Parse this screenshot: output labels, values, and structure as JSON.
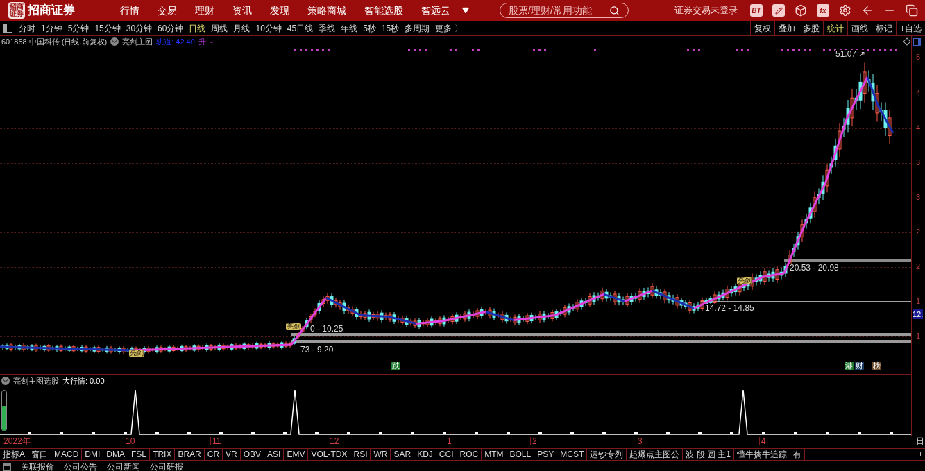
{
  "app_bar": {
    "logo_emblem": "招商证券",
    "logo_text": "招商证券",
    "nav": [
      "行情",
      "交易",
      "理财",
      "资讯",
      "发现",
      "策略商城",
      "智能选股",
      "智远云"
    ],
    "search": {
      "placeholder": "股票/理财/常用功能"
    },
    "login_status": "证券交易未登录",
    "tools": [
      {
        "kind": "text",
        "label": "BT"
      },
      {
        "kind": "pencil"
      },
      {
        "kind": "box"
      },
      {
        "kind": "text",
        "label": "fx"
      },
      {
        "kind": "gear"
      },
      {
        "kind": "back"
      },
      {
        "kind": "minimize"
      },
      {
        "kind": "restore"
      }
    ]
  },
  "periods": [
    {
      "label": "分时",
      "selected": false
    },
    {
      "label": "1分钟",
      "selected": false
    },
    {
      "label": "5分钟",
      "selected": false
    },
    {
      "label": "15分钟",
      "selected": false
    },
    {
      "label": "30分钟",
      "selected": false
    },
    {
      "label": "60分钟",
      "selected": false
    },
    {
      "label": "日线",
      "selected": true
    },
    {
      "label": "周线",
      "selected": false
    },
    {
      "label": "月线",
      "selected": false
    },
    {
      "label": "10分钟",
      "selected": false
    },
    {
      "label": "45日线",
      "selected": false
    },
    {
      "label": "季线",
      "selected": false
    },
    {
      "label": "年线",
      "selected": false
    },
    {
      "label": "5秒",
      "selected": false
    },
    {
      "label": "15秒",
      "selected": false
    },
    {
      "label": "多周期",
      "selected": false
    },
    {
      "label": "更多 〉",
      "selected": false
    }
  ],
  "chart_tools": [
    {
      "label": "复权",
      "selected": false
    },
    {
      "label": "叠加",
      "selected": false
    },
    {
      "label": "多股",
      "selected": false
    },
    {
      "label": "统计",
      "selected": true
    },
    {
      "label": "画线",
      "selected": false
    },
    {
      "label": "标记",
      "selected": false
    },
    {
      "label": "+自选",
      "selected": false
    }
  ],
  "main_chart": {
    "security": "601858 中国科传 (日线.前复权)",
    "indicator": "亮剑主图",
    "track": "轨道: 42.40",
    "rise": "升: -",
    "annotations": [
      "51.07 ↗",
      "20.53 - 20.98",
      "14.72 - 14.85",
      "0 - 10.25",
      "73 - 9.20"
    ],
    "signals": [
      "亮剑",
      "亮剑",
      "亮剑"
    ],
    "tags": [
      {
        "text": "跌",
        "color": "#1e7a2e"
      },
      {
        "text": "港",
        "color": "#1e7a2e"
      },
      {
        "text": "财",
        "color": "#16385e"
      },
      {
        "text": "榜",
        "color": "#6b4a2a"
      }
    ],
    "axis_labels": [
      "5",
      "4",
      "4",
      "3",
      "3",
      "2",
      "2",
      "1",
      "1"
    ],
    "price_tag": "12."
  },
  "sub_chart": {
    "indicator": "亮剑主图选股",
    "reading": "大行情: 0.00",
    "meter": {
      "level": 0.62
    }
  },
  "time_axis": [
    "2022年",
    "10",
    "11",
    "12",
    "1",
    "2",
    "3",
    "4"
  ],
  "time_axis_end": "日",
  "indicator_tabs": [
    "指标A",
    "窗口",
    "MACD",
    "DMI",
    "DMA",
    "FSL",
    "TRIX",
    "BRAR",
    "CR",
    "VR",
    "OBV",
    "ASI",
    "EMV",
    "VOL-TDX",
    "RSI",
    "WR",
    "SAR",
    "KDJ",
    "CCI",
    "ROC",
    "MTM",
    "BOLL",
    "PSY",
    "MCST",
    "运钞专列",
    "起爆点主图公",
    "波 段 圆 主1",
    "懂牛擒牛追踪",
    "有"
  ],
  "tabs_add": "+",
  "bottom_links": [
    "关联报价",
    "公司公告",
    "公司新闻",
    "公司研报"
  ]
}
